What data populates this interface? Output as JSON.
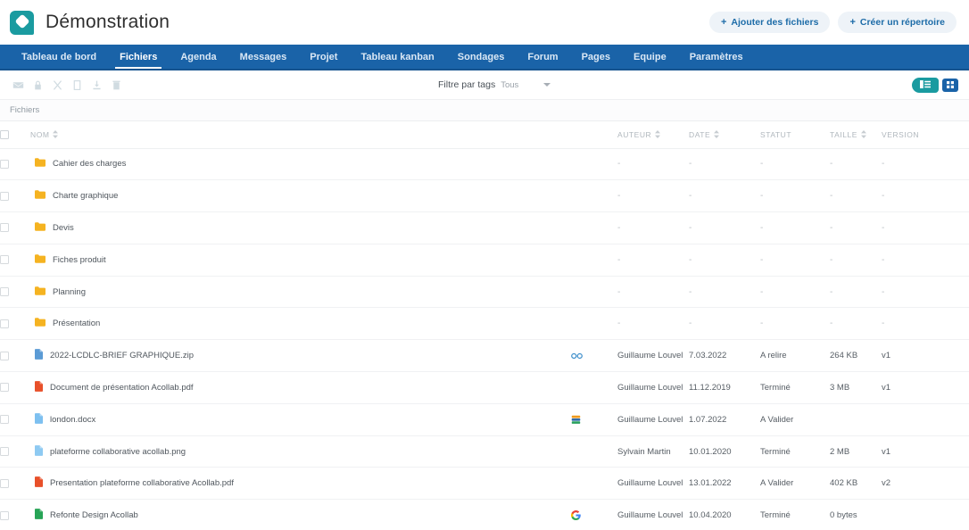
{
  "header": {
    "logo_icon": "acollab-logo-icon",
    "title": "Démonstration",
    "actions": [
      {
        "icon": "plus-icon",
        "plus": "+",
        "label": "Ajouter des fichiers",
        "name": "add-files-button"
      },
      {
        "icon": "plus-icon",
        "plus": "+",
        "label": "Créer un répertoire",
        "name": "create-directory-button"
      }
    ]
  },
  "nav": {
    "items": [
      {
        "label": "Tableau de bord",
        "active": false
      },
      {
        "label": "Fichiers",
        "active": true
      },
      {
        "label": "Agenda",
        "active": false
      },
      {
        "label": "Messages",
        "active": false
      },
      {
        "label": "Projet",
        "active": false
      },
      {
        "label": "Tableau kanban",
        "active": false
      },
      {
        "label": "Sondages",
        "active": false
      },
      {
        "label": "Forum",
        "active": false
      },
      {
        "label": "Pages",
        "active": false
      },
      {
        "label": "Equipe",
        "active": false
      },
      {
        "label": "Paramètres",
        "active": false
      }
    ]
  },
  "toolbar": {
    "icons": [
      {
        "name": "mail-icon"
      },
      {
        "name": "lock-icon"
      },
      {
        "name": "cut-icon"
      },
      {
        "name": "copy-icon"
      },
      {
        "name": "download-icon"
      },
      {
        "name": "trash-icon"
      }
    ],
    "filter_label": "Filtre par tags",
    "filter_value": "Tous",
    "view_list_label": "list-view",
    "view_grid_label": "grid-view"
  },
  "breadcrumb": {
    "current": "Fichiers"
  },
  "table": {
    "columns": [
      {
        "key": "name",
        "label": "NOM",
        "sortable": true
      },
      {
        "key": "author",
        "label": "AUTEUR",
        "sortable": true
      },
      {
        "key": "date",
        "label": "DATE",
        "sortable": true
      },
      {
        "key": "status",
        "label": "STATUT",
        "sortable": false
      },
      {
        "key": "size",
        "label": "TAILLE",
        "sortable": true
      },
      {
        "key": "version",
        "label": "VERSION",
        "sortable": false
      }
    ],
    "rows": [
      {
        "type": "folder",
        "icon": "folder-icon",
        "name": "Cahier des charges",
        "badge": "",
        "author": "-",
        "date": "-",
        "status": "-",
        "size": "-",
        "version": "-"
      },
      {
        "type": "folder",
        "icon": "folder-icon",
        "name": "Charte graphique",
        "badge": "",
        "author": "-",
        "date": "-",
        "status": "-",
        "size": "-",
        "version": "-"
      },
      {
        "type": "folder",
        "icon": "folder-icon",
        "name": "Devis",
        "badge": "",
        "author": "-",
        "date": "-",
        "status": "-",
        "size": "-",
        "version": "-"
      },
      {
        "type": "folder",
        "icon": "folder-icon",
        "name": "Fiches produit",
        "badge": "",
        "author": "-",
        "date": "-",
        "status": "-",
        "size": "-",
        "version": "-"
      },
      {
        "type": "folder",
        "icon": "folder-icon",
        "name": "Planning",
        "badge": "",
        "author": "-",
        "date": "-",
        "status": "-",
        "size": "-",
        "version": "-"
      },
      {
        "type": "folder",
        "icon": "folder-icon",
        "name": "Présentation",
        "badge": "",
        "author": "-",
        "date": "-",
        "status": "-",
        "size": "-",
        "version": "-"
      },
      {
        "type": "zip",
        "icon": "file-zip-icon",
        "name": "2022-LCDLC-BRIEF GRAPHIQUE.zip",
        "badge": "link-icon",
        "author": "Guillaume Louvel",
        "date": "7.03.2022",
        "status": "A relire",
        "size": "264 KB",
        "version": "v1"
      },
      {
        "type": "pdf",
        "icon": "file-pdf-icon",
        "name": "Document de présentation Acollab.pdf",
        "badge": "",
        "author": "Guillaume Louvel",
        "date": "11.12.2019",
        "status": "Terminé",
        "size": "3 MB",
        "version": "v1"
      },
      {
        "type": "docx",
        "icon": "file-doc-icon",
        "name": "london.docx",
        "badge": "onlyoffice-icon",
        "author": "Guillaume Louvel",
        "date": "1.07.2022",
        "status": "A Valider",
        "size": "",
        "version": ""
      },
      {
        "type": "png",
        "icon": "file-img-icon",
        "name": "plateforme collaborative acollab.png",
        "badge": "",
        "author": "Sylvain Martin",
        "date": "10.01.2020",
        "status": "Terminé",
        "size": "2 MB",
        "version": "v1"
      },
      {
        "type": "pdf",
        "icon": "file-pdf-icon",
        "name": "Presentation plateforme collaborative Acollab.pdf",
        "badge": "",
        "author": "Guillaume Louvel",
        "date": "13.01.2022",
        "status": "A Valider",
        "size": "402 KB",
        "version": "v2"
      },
      {
        "type": "gsheet",
        "icon": "file-sheet-icon",
        "name": "Refonte Design Acollab",
        "badge": "google-icon",
        "author": "Guillaume Louvel",
        "date": "10.04.2020",
        "status": "Terminé",
        "size": "0 bytes",
        "version": ""
      }
    ]
  },
  "colors": {
    "nav_blue": "#1a63a8",
    "brand_teal": "#1a9ba0",
    "folder_amber": "#f5b321",
    "pdf_red": "#e8502a",
    "doc_blue": "#5ca9e8",
    "sheet_green": "#27a456"
  }
}
